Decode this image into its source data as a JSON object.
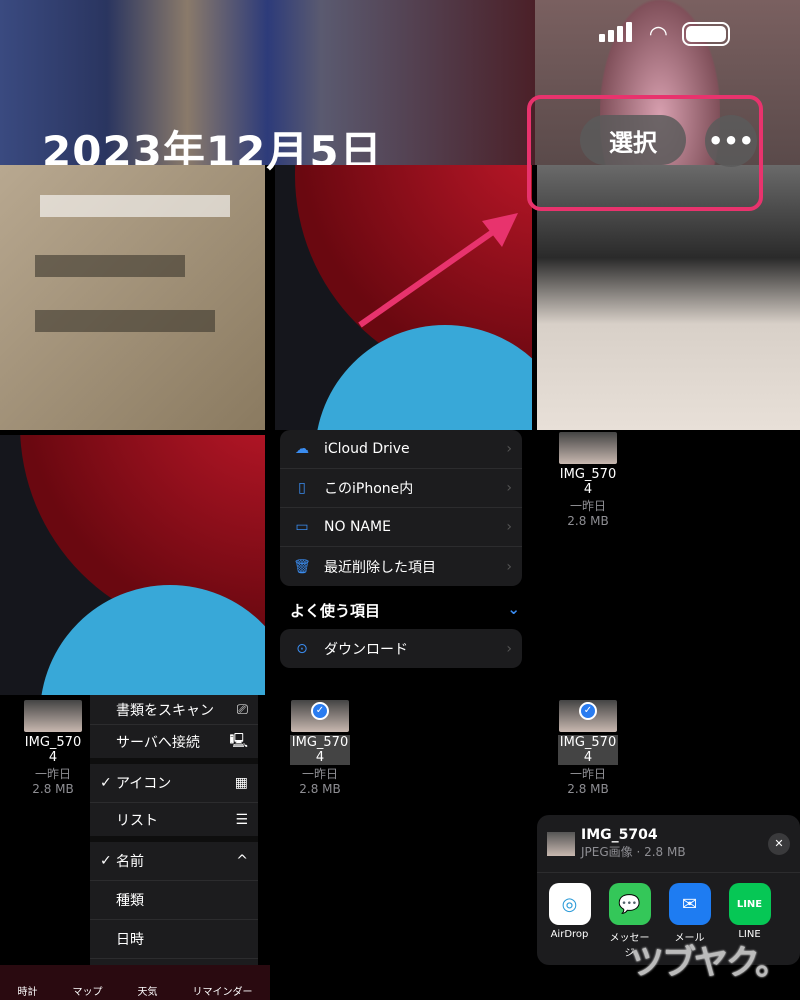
{
  "header": {
    "title": "2023年12月5日",
    "select_label": "選択",
    "more_label": "•••"
  },
  "status": {
    "wifi": "wifi-icon",
    "battery": "battery-icon",
    "signal": "signal-icon"
  },
  "accent": "#e8336d",
  "locations": [
    {
      "label": "iCloud Drive",
      "icon": "cloud-icon"
    },
    {
      "label": "このiPhone内",
      "icon": "iphone-icon"
    },
    {
      "label": "NO NAME",
      "icon": "drive-icon"
    },
    {
      "label": "最近削除した項目",
      "icon": "trash-icon"
    }
  ],
  "favorites": {
    "title": "よく使う項目",
    "items": [
      {
        "label": "ダウンロード",
        "icon": "download-icon"
      }
    ]
  },
  "file": {
    "name_line1": "IMG_570",
    "name_line2": "4",
    "date": "一昨日",
    "size": "2.8 MB"
  },
  "menu": {
    "items": [
      {
        "label": "書類をスキャン",
        "check": "",
        "icon": "⎚"
      },
      {
        "label": "サーバへ接続",
        "check": "",
        "icon": "🖳"
      },
      {
        "label": "アイコン",
        "check": "✓",
        "icon": "▦"
      },
      {
        "label": "リスト",
        "check": "",
        "icon": "☰"
      },
      {
        "label": "名前",
        "check": "✓",
        "icon": "^"
      },
      {
        "label": "種類",
        "check": "",
        "icon": ""
      },
      {
        "label": "日時",
        "check": "",
        "icon": ""
      }
    ]
  },
  "dock": [
    "時計",
    "マップ",
    "天気",
    "リマインダー"
  ],
  "share": {
    "title": "IMG_5704",
    "subtitle": "JPEG画像 · 2.8 MB",
    "close": "✕",
    "apps": [
      {
        "label": "AirDrop",
        "color": "#ffffff"
      },
      {
        "label": "メッセージ",
        "color": "#34c759"
      },
      {
        "label": "メール",
        "color": "#1e7cf2"
      },
      {
        "label": "LINE",
        "color": "#06c755"
      }
    ]
  },
  "watermark": "ツブヤク。"
}
